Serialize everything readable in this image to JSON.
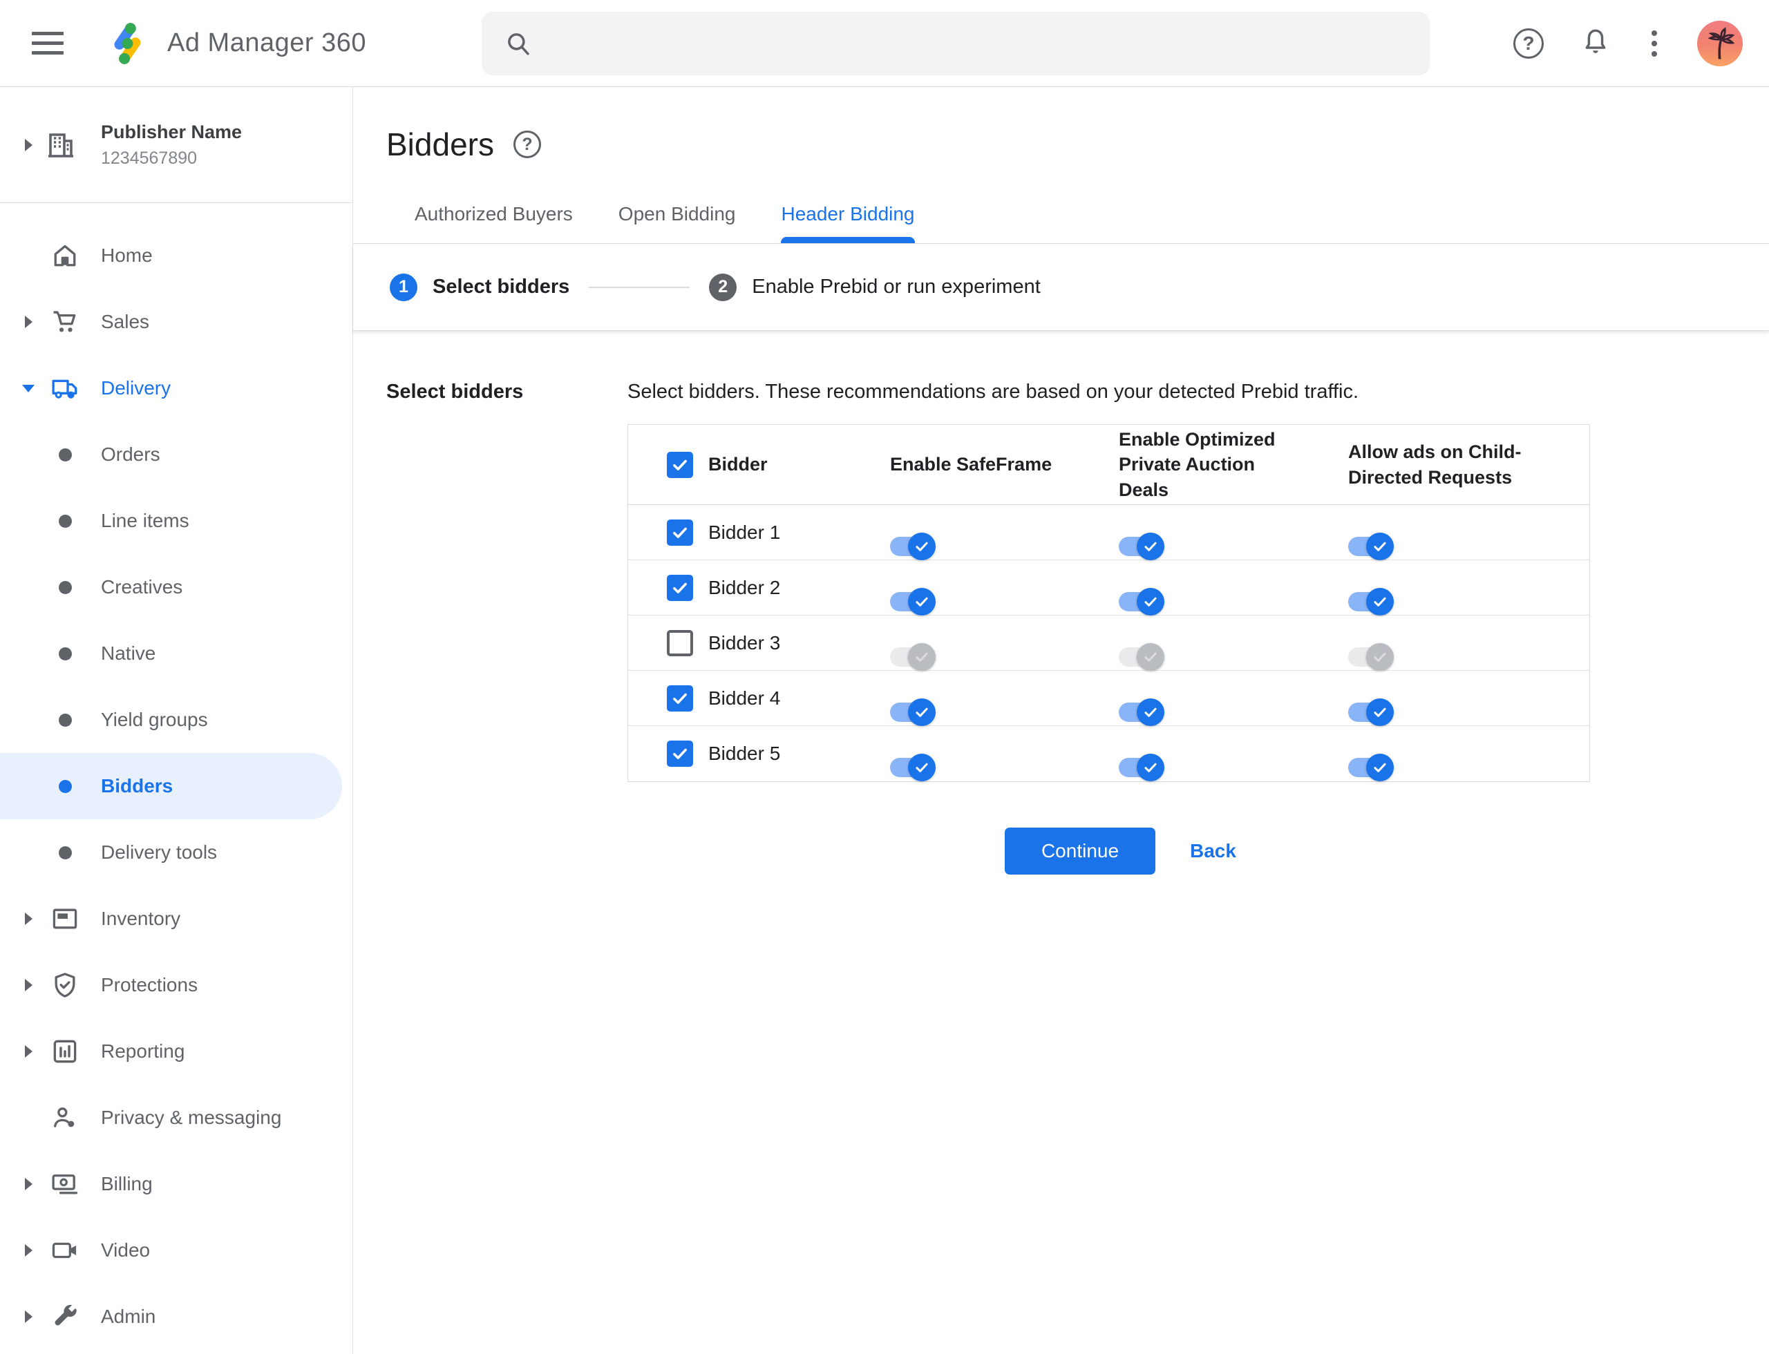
{
  "colors": {
    "accent_blue": "#1a73e8",
    "selected_item_bg": "#e8f0fe",
    "toggle_on_track": "#8ab4f8",
    "toggle_off_track": "#e9eaec",
    "toggle_off_thumb": "#b9bdc2",
    "text_gray": "#5f6368"
  },
  "topbar": {
    "app_title": "Ad Manager 360",
    "menu_icon": "hamburger",
    "search": {
      "value": "",
      "icon": "magnifier"
    },
    "help_icon": "question-circle",
    "notifications_icon": "bell",
    "overflow_icon": "kebab-vertical",
    "avatar": "palm-tree-sunset-photo"
  },
  "sidebar": {
    "publisher": {
      "name": "Publisher Name",
      "id": "1234567890",
      "icon": "building",
      "lead": "chevron-right"
    },
    "items": [
      {
        "label": "Home",
        "icon": "home",
        "lead": "none"
      },
      {
        "label": "Sales",
        "icon": "cart",
        "lead": "chevron-right"
      },
      {
        "label": "Delivery",
        "icon": "truck",
        "lead": "chevron-down",
        "active": true
      },
      {
        "label": "Orders",
        "icon": "bullet",
        "lead": "none"
      },
      {
        "label": "Line items",
        "icon": "bullet",
        "lead": "none"
      },
      {
        "label": "Creatives",
        "icon": "bullet",
        "lead": "none"
      },
      {
        "label": "Native",
        "icon": "bullet",
        "lead": "none"
      },
      {
        "label": "Yield groups",
        "icon": "bullet",
        "lead": "none"
      },
      {
        "label": "Bidders",
        "icon": "bullet",
        "lead": "none",
        "active": true,
        "selected": true
      },
      {
        "label": "Delivery tools",
        "icon": "bullet",
        "lead": "none"
      },
      {
        "label": "Inventory",
        "icon": "adunit",
        "lead": "chevron-right"
      },
      {
        "label": "Protections",
        "icon": "shield",
        "lead": "chevron-right"
      },
      {
        "label": "Reporting",
        "icon": "report",
        "lead": "chevron-right"
      },
      {
        "label": "Privacy & messaging",
        "icon": "privacy",
        "lead": "none"
      },
      {
        "label": "Billing",
        "icon": "billing",
        "lead": "chevron-right"
      },
      {
        "label": "Video",
        "icon": "video",
        "lead": "chevron-right"
      },
      {
        "label": "Admin",
        "icon": "admin",
        "lead": "chevron-right"
      }
    ]
  },
  "main": {
    "page_title": "Bidders",
    "title_help_icon": "question-circle",
    "tabs": [
      {
        "label": "Authorized Buyers",
        "active": false
      },
      {
        "label": "Open Bidding",
        "active": false
      },
      {
        "label": "Header Bidding",
        "active": true
      }
    ],
    "stepper": {
      "steps": [
        {
          "number": "1",
          "label": "Select bidders",
          "state": "current"
        },
        {
          "number": "2",
          "label": "Enable Prebid or run experiment",
          "state": "upcoming"
        }
      ]
    },
    "section_label": "Select bidders",
    "description": "Select bidders. These recommendations are based on your detected Prebid traffic.",
    "table": {
      "select_all_checked": true,
      "columns": [
        "Bidder",
        "Enable SafeFrame",
        "Enable Optimized Private Auction Deals",
        "Allow ads on Child-Directed Requests"
      ],
      "rows": [
        {
          "name": "Bidder 1",
          "checked": true,
          "safeframe": true,
          "optimized_deals": true,
          "child_directed": true
        },
        {
          "name": "Bidder 2",
          "checked": true,
          "safeframe": true,
          "optimized_deals": true,
          "child_directed": true
        },
        {
          "name": "Bidder 3",
          "checked": false,
          "safeframe": false,
          "optimized_deals": false,
          "child_directed": false
        },
        {
          "name": "Bidder 4",
          "checked": true,
          "safeframe": true,
          "optimized_deals": true,
          "child_directed": true
        },
        {
          "name": "Bidder 5",
          "checked": true,
          "safeframe": true,
          "optimized_deals": true,
          "child_directed": true
        }
      ]
    },
    "continue_label": "Continue",
    "back_label": "Back"
  }
}
